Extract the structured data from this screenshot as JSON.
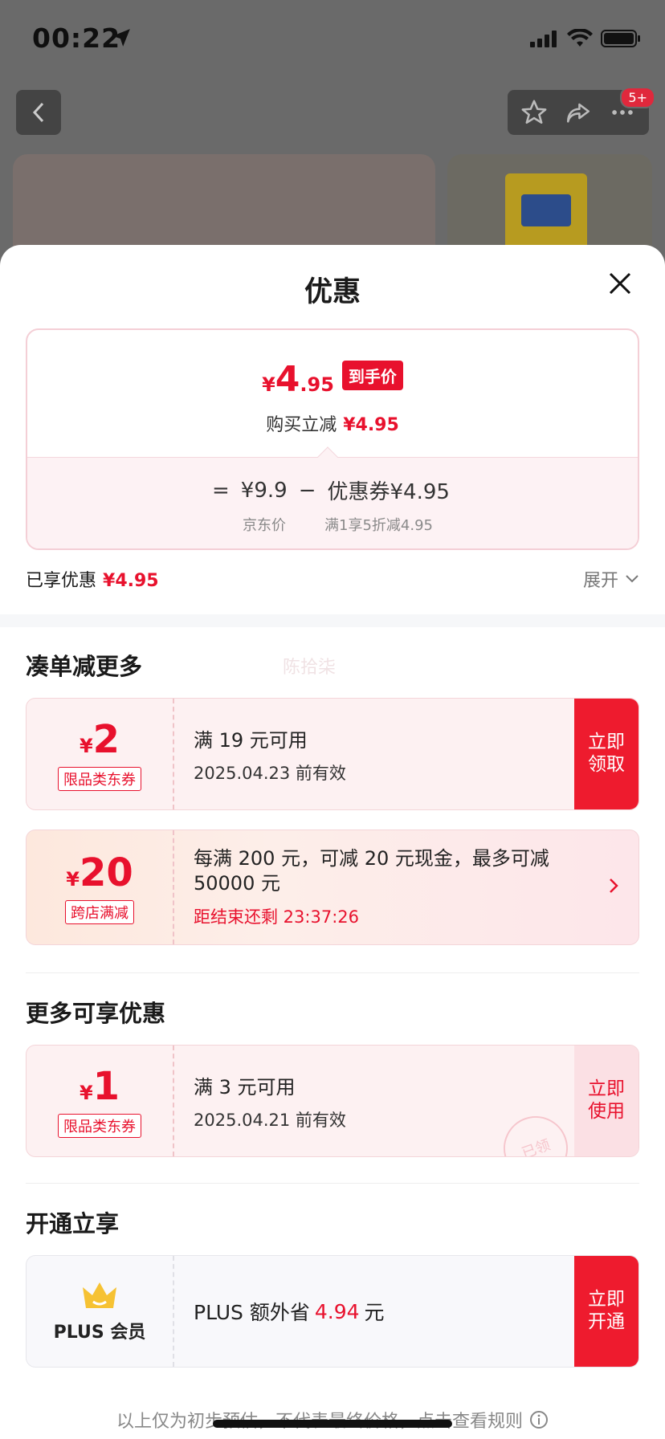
{
  "status": {
    "time": "00:22"
  },
  "header": {
    "badge": "5+"
  },
  "sheet": {
    "title": "优惠",
    "price_card": {
      "final_yen": "¥",
      "final_int": "4",
      "final_dec": ".95",
      "final_tag": "到手价",
      "reduce_label": "购买立减",
      "reduce_value": "¥4.95",
      "eq": "=",
      "base_price": "¥9.9",
      "minus": "−",
      "coupon_label": "优惠券¥4.95",
      "base_price_label": "京东价",
      "coupon_desc": "满1享5折减4.95"
    },
    "enjoyed": {
      "label": "已享优惠",
      "value": "¥4.95",
      "expand": "展开"
    },
    "watermark": "陈拾柒",
    "section1": {
      "title": "凑单减更多",
      "coupon1": {
        "yen": "¥",
        "amount": "2",
        "tag": "限品类东券",
        "cond": "满 19 元可用",
        "valid": "2025.04.23 前有效",
        "button": "立即领取"
      },
      "coupon2": {
        "yen": "¥",
        "amount": "20",
        "tag": "跨店满减",
        "desc": "每满 200 元，可减 20 元现金，最多可减 50000 元",
        "countdown": "距结束还剩 23:37:26"
      }
    },
    "section2": {
      "title": "更多可享优惠",
      "coupon": {
        "yen": "¥",
        "amount": "1",
        "tag": "限品类东券",
        "cond": "满 3 元可用",
        "valid": "2025.04.21 前有效",
        "button": "立即使用",
        "stamp": "已领"
      }
    },
    "section3": {
      "title": "开通立享",
      "plus": {
        "label": "PLUS 会员",
        "text_pre": "PLUS 额外省",
        "value": "4.94",
        "text_post": "元",
        "button": "立即开通"
      }
    },
    "footer": "以上仅为初步预估，不代表最终价格，点击查看规则"
  },
  "colors": {
    "accent": "#e8112d",
    "button": "#ee1b2e",
    "coupon_bg": "#fdf1f2"
  }
}
